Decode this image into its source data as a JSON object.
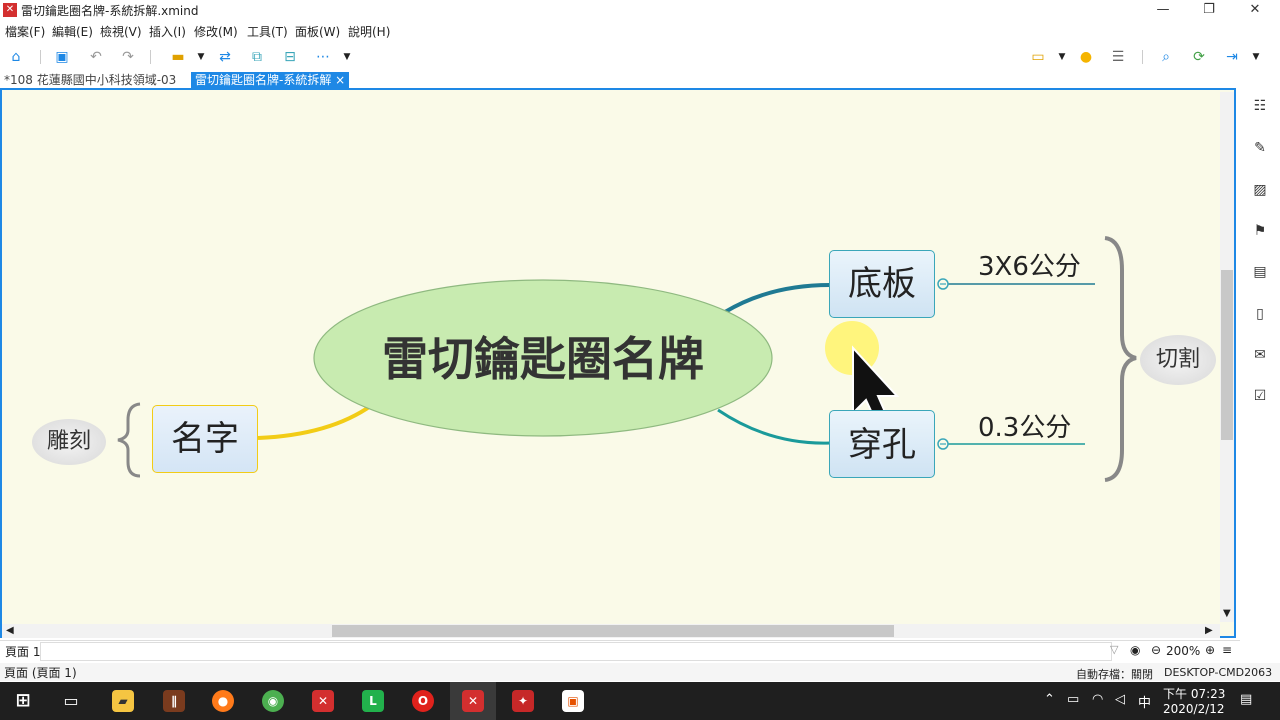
{
  "window": {
    "title": "雷切鑰匙圈名牌-系統拆解.xmind",
    "app_icon": "xmind-icon"
  },
  "menu": [
    "檔案(F)",
    "編輯(E)",
    "檢視(V)",
    "插入(I)",
    "修改(M)",
    "工具(T)",
    "面板(W)",
    "說明(H)"
  ],
  "tabs": [
    {
      "label": "*108 花蓮縣國中小科技領域-03",
      "active": false
    },
    {
      "label": "雷切鑰匙圈名牌-系統拆解",
      "active": true,
      "close": "×"
    }
  ],
  "mindmap": {
    "central": "雷切鑰匙圈名牌",
    "left_topic": "名字",
    "left_summary": "雕刻",
    "right_topics": [
      {
        "label": "底板",
        "detail": "3X6公分"
      },
      {
        "label": "穿孔",
        "detail": "0.3公分"
      }
    ],
    "right_summary": "切割",
    "colors": {
      "central_fill": "#c8ebb0",
      "left_branch": "#f2cc16",
      "right_branch_top": "#1f7a93",
      "right_branch_bottom": "#1a9a9a",
      "topic_border": "#3aa6b9",
      "canvas_bg": "#fafae8",
      "accent": "#1e88e5"
    }
  },
  "sheet": {
    "tab": "頁面 1",
    "zoom": "200%"
  },
  "status": {
    "left": "頁面 (頁面 1)",
    "autosave": "自動存檔：關閉",
    "host": "DESKTOP-CMD2063"
  },
  "taskbar": {
    "time": "下午 07:23",
    "date": "2020/2/12",
    "ime": "中"
  }
}
